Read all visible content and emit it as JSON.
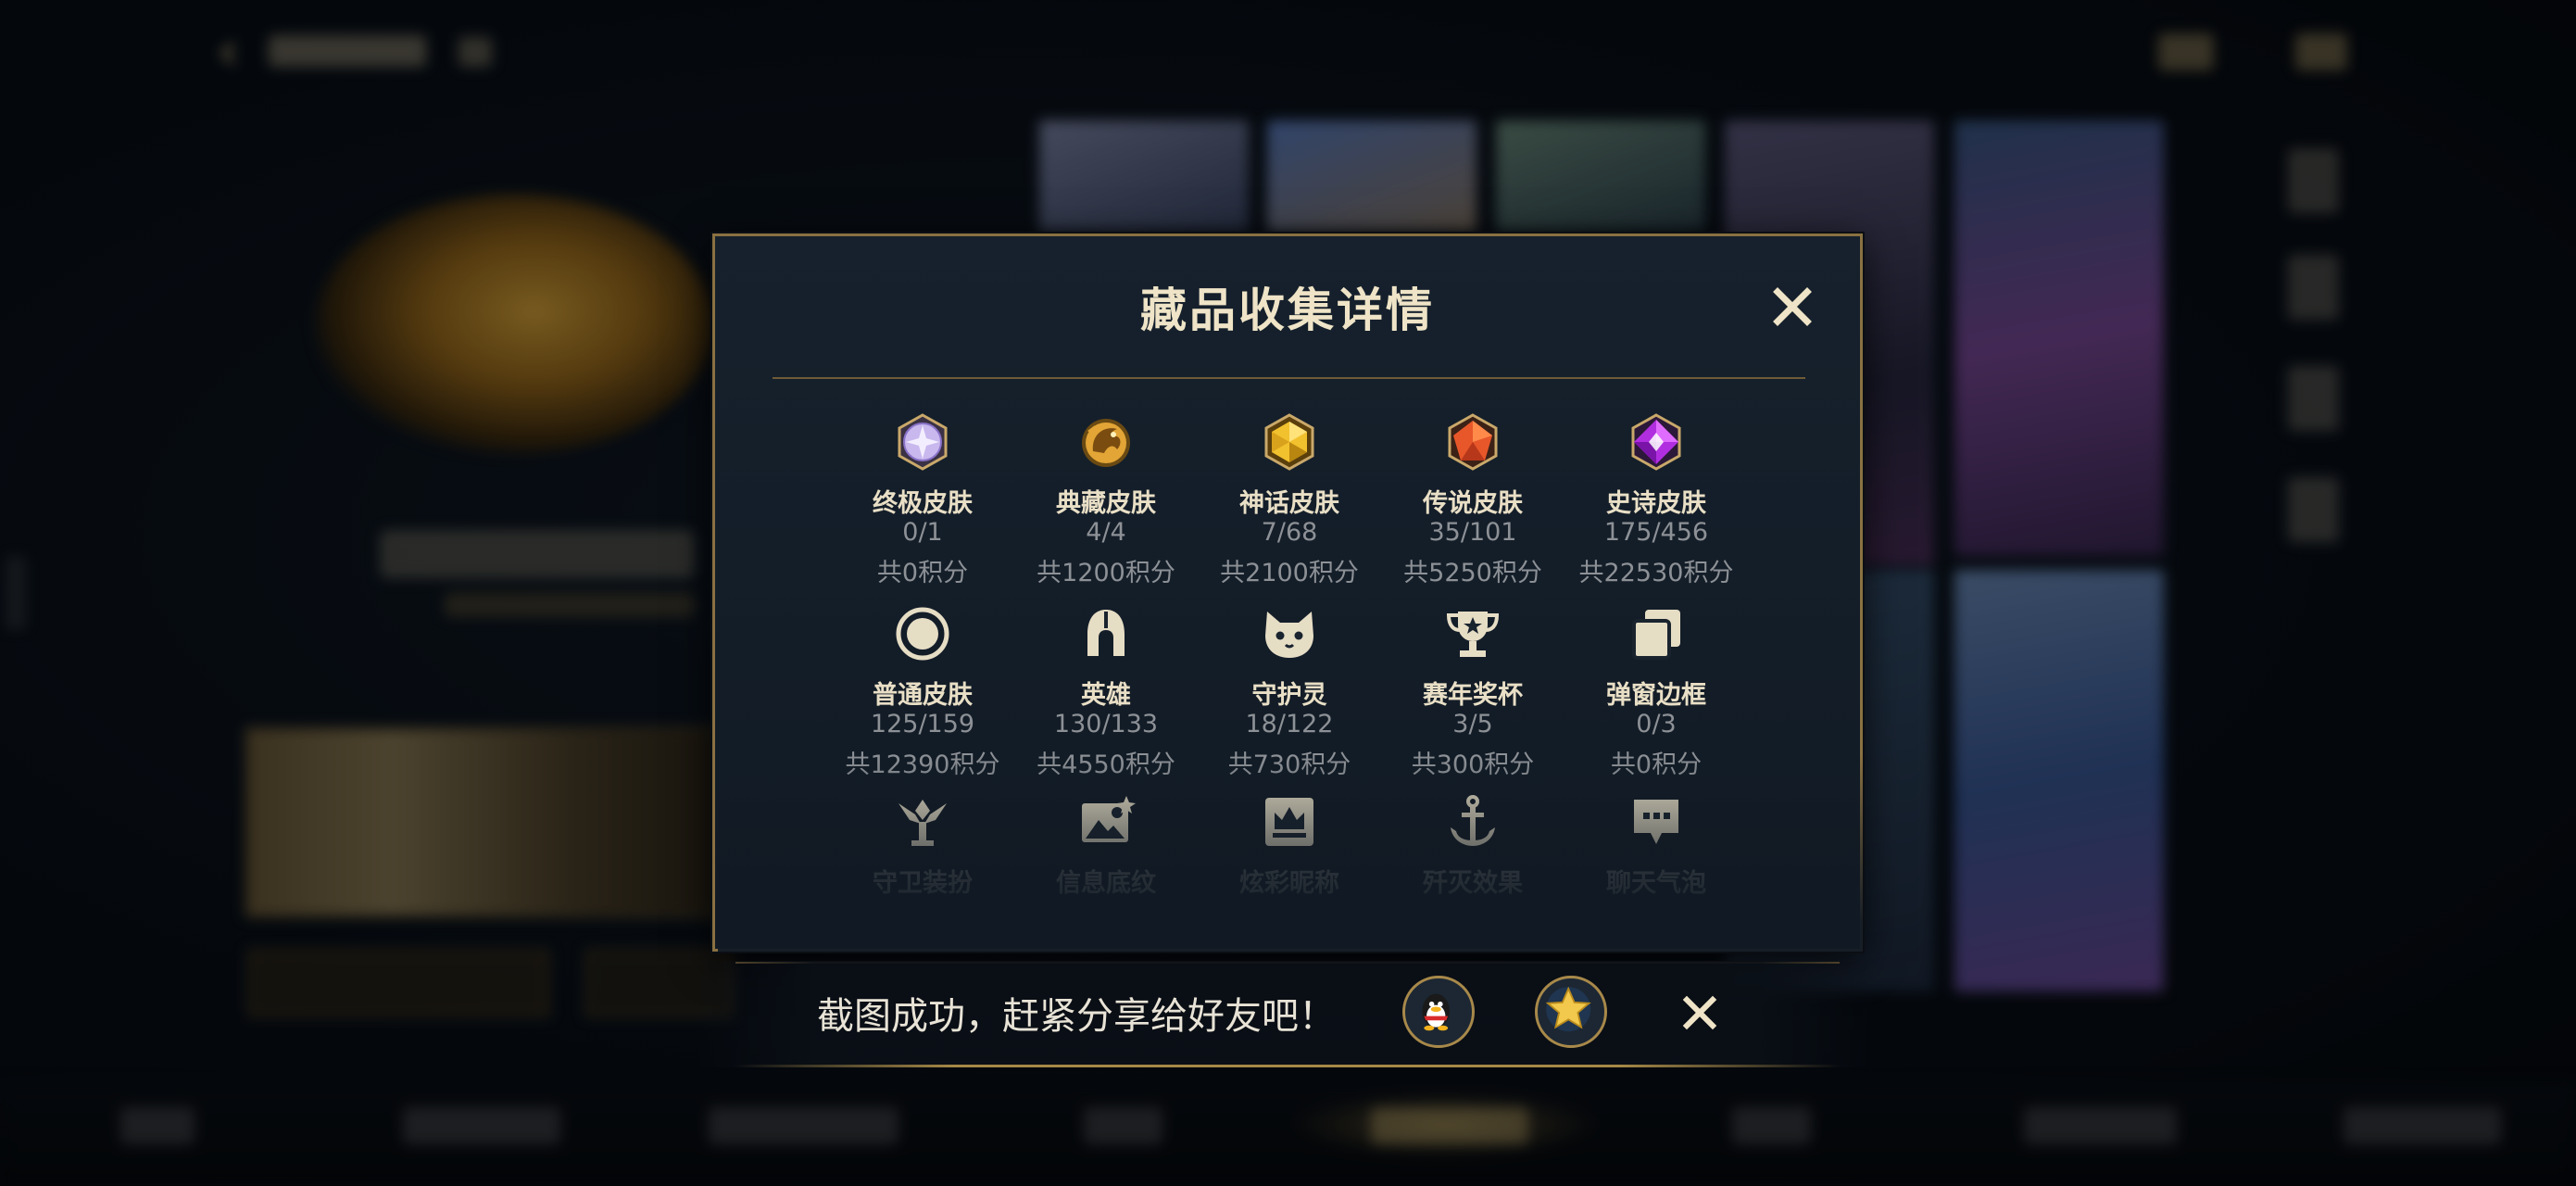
{
  "modal": {
    "title": "藏品收集详情",
    "categories": [
      {
        "label": "终极皮肤",
        "count": "0/1",
        "points": "共0积分",
        "icon": "ultimate-gem-icon"
      },
      {
        "label": "典藏皮肤",
        "count": "4/4",
        "points": "共1200积分",
        "icon": "dragon-medallion-icon"
      },
      {
        "label": "神话皮肤",
        "count": "7/68",
        "points": "共2100积分",
        "icon": "mythic-gem-icon"
      },
      {
        "label": "传说皮肤",
        "count": "35/101",
        "points": "共5250积分",
        "icon": "legendary-gem-icon"
      },
      {
        "label": "史诗皮肤",
        "count": "175/456",
        "points": "共22530积分",
        "icon": "epic-gem-icon"
      },
      {
        "label": "普通皮肤",
        "count": "125/159",
        "points": "共12390积分",
        "icon": "common-ring-icon"
      },
      {
        "label": "英雄",
        "count": "130/133",
        "points": "共4550积分",
        "icon": "helmet-icon"
      },
      {
        "label": "守护灵",
        "count": "18/122",
        "points": "共730积分",
        "icon": "poro-icon"
      },
      {
        "label": "赛年奖杯",
        "count": "3/5",
        "points": "共300积分",
        "icon": "trophy-icon"
      },
      {
        "label": "弹窗边框",
        "count": "0/3",
        "points": "共0积分",
        "icon": "stacked-frames-icon"
      },
      {
        "label": "守卫装扮",
        "icon": "ward-skin-icon"
      },
      {
        "label": "信息底纹",
        "icon": "profile-banner-icon"
      },
      {
        "label": "炫彩昵称",
        "icon": "crown-nameplate-icon"
      },
      {
        "label": "歼灭效果",
        "icon": "anchor-icon"
      },
      {
        "label": "聊天气泡",
        "icon": "chat-bubble-icon"
      }
    ]
  },
  "toast": {
    "text": "截图成功，赶紧分享给好友吧！",
    "share_qq_icon": "qq-penguin-icon",
    "share_star_icon": "star-icon"
  },
  "colors": {
    "accent_gold": "#a8894a",
    "title_text": "#efe4c7",
    "muted_text": "#8d9196"
  }
}
